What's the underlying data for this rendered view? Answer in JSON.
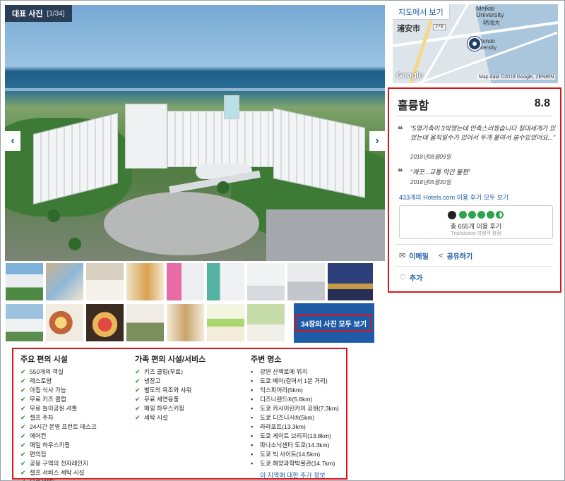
{
  "gallery": {
    "badge_title": "대표 사진",
    "badge_count": "[1/34]",
    "prev_icon": "‹",
    "next_icon": "›",
    "see_all_label": "34장의 사진 모두 보기"
  },
  "map": {
    "view_map_label": "지도에서 보기",
    "city_label": "浦安市",
    "route_label": "276",
    "univ_label": "Meikai University",
    "univ_kanji": "明海大",
    "univ2_label": "Juntendo University",
    "google_label": "Google",
    "credit": "Map data ©2018 Google, ZENRIN"
  },
  "review": {
    "rating_word": "훌륭함",
    "score": "8.8",
    "quotes": [
      {
        "text": "“5명가족이 3박했는데 만족스러웠습니다 침대세개가 있었는데 움직일수가 있어서 두개 붙여서 쓸수있었어요...”",
        "date": "2018년08월09일"
      },
      {
        "text": "“깨끗...교통 약간 불편”",
        "date": "2018년05월30일"
      }
    ],
    "all_reviews_link": "433개의 Hotels.com 이용 후기 모두 보기",
    "tripadvisor": {
      "count": "총 655개 이용 후기",
      "sub": "TripAdvisor 여행객 평점",
      "score_circles": 4.5
    },
    "email_label": "이메일",
    "share_label": "공유하기",
    "add_label": "추가"
  },
  "amenities": {
    "main_title": "주요 편의 시설",
    "main_items": [
      "550개의 객실",
      "레스토랑",
      "아침 식사 가능",
      "무료 키즈 클럽",
      "무료 놀이공원 셔틀",
      "셀프 주차",
      "24시간 운영 프런트 데스크",
      "에어컨",
      "매일 하우스키핑",
      "편의점",
      "공용 구역의 전자레인지",
      "셀프 서비스 세탁 시설",
      "무료 WiFi"
    ],
    "family_title": "가족 편의 시설/서비스",
    "family_items": [
      "키즈 클럽(무료)",
      "냉장고",
      "별도의 욕조와 샤워",
      "무료 세면용품",
      "매일 하우스키핑",
      "세탁 시설"
    ],
    "nearby_title": "주변 명소",
    "nearby_items": [
      "강변 산책로에 위치",
      "도쿄 베이(걸어서 1분 거리)",
      "익스피어리(5km)",
      "디즈니랜드®(5.6km)",
      "도쿄 카사이린카이 공원(7.3km)",
      "도쿄 디즈니시®(5km)",
      "라라포트(13.3km)",
      "도쿄 게이트 브리지(13.8km)",
      "파나소닉센터 도쿄(14.3km)",
      "도쿄 빅 사이트(14.5km)",
      "도쿄 해양과학박물관(14.7km)"
    ],
    "nearby_more": "이 지역에 대한 추가 정보"
  },
  "colors": {
    "accent": "#1f5ca8",
    "highlight": "#d9141b",
    "badge": "#2a3f57",
    "check": "#2a8a2a"
  }
}
